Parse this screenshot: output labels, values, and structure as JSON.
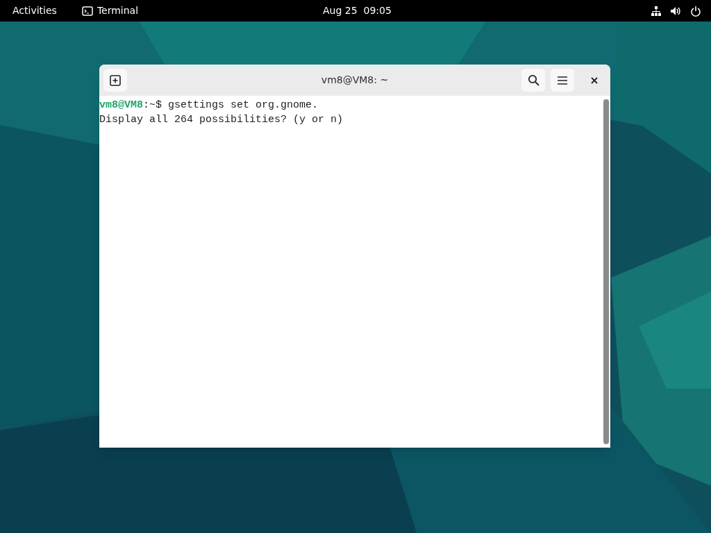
{
  "top_bar": {
    "activities": "Activities",
    "app_name": "Terminal",
    "clock": "Aug 25  09:05"
  },
  "window": {
    "title": "vm8@VM8: ~",
    "lines": [
      {
        "kind": "prompt",
        "user_host": "vm8@VM8",
        "rest": ":~$ gsettings set org.gnome."
      },
      {
        "kind": "output",
        "text": "Display all 264 possibilities? (y or n)"
      }
    ]
  }
}
